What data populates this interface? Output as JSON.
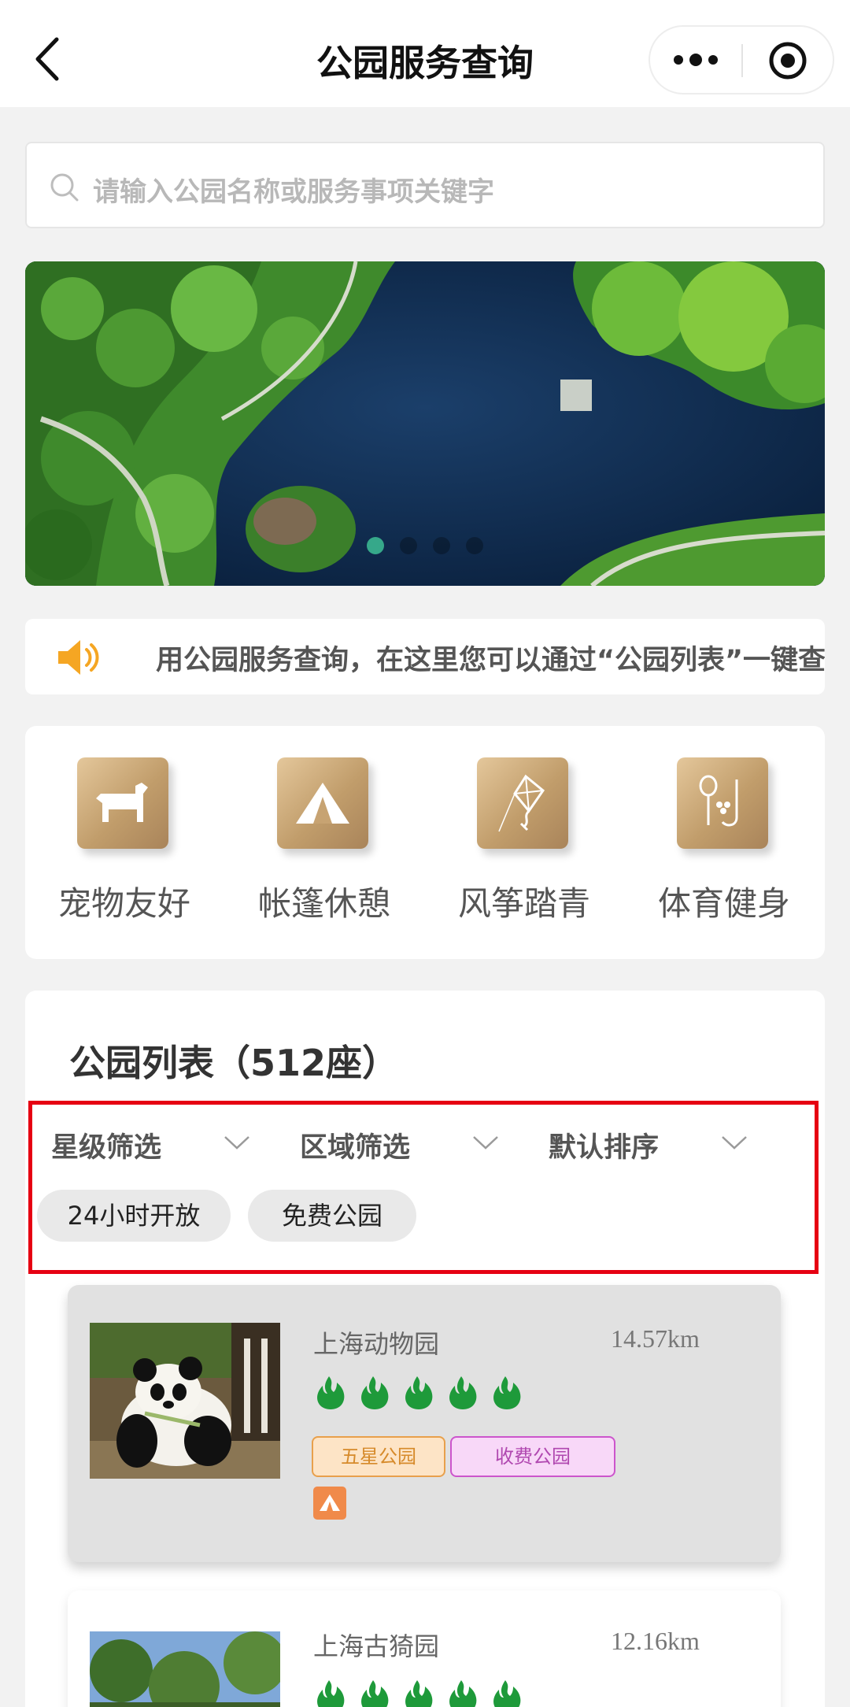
{
  "navbar": {
    "title": "公园服务查询"
  },
  "search": {
    "placeholder": "请输入公园名称或服务事项关键字"
  },
  "banner": {
    "slide_count": 4,
    "active_index": 0
  },
  "notice": {
    "text": "用公园服务查询，在这里您可以通过“公园列表”一键查询"
  },
  "categories": [
    {
      "label": "宠物友好",
      "icon": "dog-icon"
    },
    {
      "label": "帐篷休憩",
      "icon": "tent-icon"
    },
    {
      "label": "风筝踏青",
      "icon": "kite-icon"
    },
    {
      "label": "体育健身",
      "icon": "sports-racket-icon"
    }
  ],
  "park_list": {
    "title": "公园列表（512座）",
    "filters": [
      {
        "label": "星级筛选"
      },
      {
        "label": "区域筛选"
      },
      {
        "label": "默认排序"
      }
    ],
    "chips": [
      {
        "label": "24小时开放"
      },
      {
        "label": "免费公园"
      }
    ],
    "parks": [
      {
        "name": "上海动物园",
        "distance": "14.57km",
        "rating": 5,
        "tags": [
          "五星公园",
          "收费公园"
        ],
        "facility_icon": "tent-icon"
      },
      {
        "name": "上海古猗园",
        "distance": "12.16km",
        "rating": 5,
        "tags": []
      }
    ]
  },
  "colors": {
    "highlight_border": "#e60012",
    "category_gold": "#c19d6b",
    "flame_green": "#1e9a3a",
    "active_dot": "#36a88a"
  }
}
